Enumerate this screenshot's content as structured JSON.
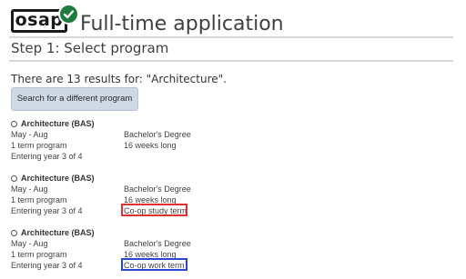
{
  "header": {
    "logo_text": "osap",
    "app_title": "Full-time application"
  },
  "step_title": "Step 1: Select program",
  "results_text": "There are 13 results for: \"Architecture\".",
  "search_button_label": "Search for a different program",
  "highlight_colors": {
    "red": "#e0332f",
    "blue": "#2b46d1"
  },
  "programs": [
    {
      "name": "Architecture (BAS)",
      "term": "May - Aug",
      "degree": "Bachelor's Degree",
      "program_length": "1 term program",
      "weeks": "16 weeks long",
      "entering": "Entering year 3 of 4",
      "note": ""
    },
    {
      "name": "Architecture (BAS)",
      "term": "May - Aug",
      "degree": "Bachelor's Degree",
      "program_length": "1 term program",
      "weeks": "16 weeks long",
      "entering": "Entering year 3 of 4",
      "note": "Co-op study term"
    },
    {
      "name": "Architecture (BAS)",
      "term": "May - Aug",
      "degree": "Bachelor's Degree",
      "program_length": "1 term program",
      "weeks": "16 weeks long",
      "entering": "Entering year 3 of 4",
      "note": "Co-op work term"
    }
  ]
}
